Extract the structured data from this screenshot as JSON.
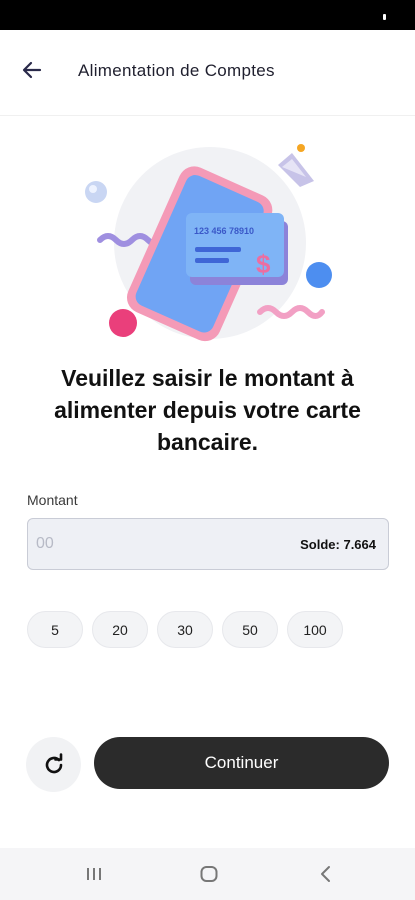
{
  "header": {
    "title": "Alimentation de Comptes",
    "back_icon": "arrow-left-icon"
  },
  "illustration": {
    "card_number": "123 456 78910",
    "currency_symbol": "$"
  },
  "headline": "Veuillez saisir le montant à alimenter depuis votre carte bancaire.",
  "form": {
    "amount_label": "Montant",
    "amount_placeholder": "00",
    "amount_value": "",
    "balance": "Solde: 7.664"
  },
  "quick_amounts": [
    "5",
    "20",
    "30",
    "50",
    "100"
  ],
  "actions": {
    "refresh_icon": "refresh-icon",
    "continue_label": "Continuer"
  },
  "system_nav": {
    "recents_icon": "recents-icon",
    "home_icon": "home-icon",
    "back_icon": "back-chevron-icon"
  },
  "colors": {
    "primary_button": "#2b2b2b",
    "input_background": "#eef0f5",
    "accent_blue": "#5b8ff5",
    "accent_pink": "#f38fb2"
  }
}
